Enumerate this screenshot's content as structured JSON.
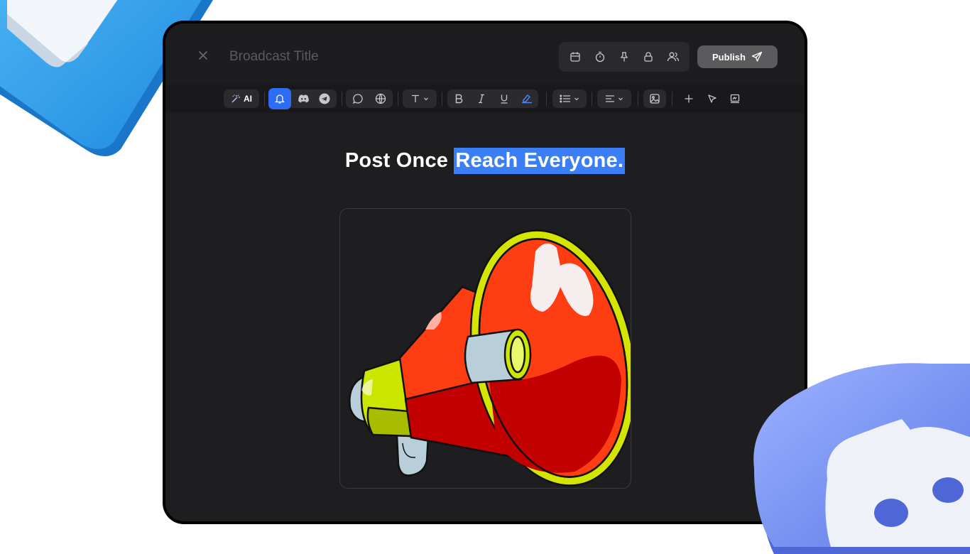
{
  "header": {
    "close_icon": "close-icon",
    "title_placeholder": "Broadcast Title",
    "icons": [
      "calendar-icon",
      "timer-icon",
      "pin-icon",
      "lock-icon",
      "users-icon"
    ],
    "publish_label": "Publish"
  },
  "toolbar": {
    "ai_label": "AI",
    "groups": [
      [
        "ai-magic-icon"
      ],
      [
        "bell-icon",
        "discord-icon",
        "telegram-icon"
      ],
      [
        "chat-bubble-icon",
        "globe-icon"
      ],
      [
        "text-type-icon"
      ],
      [
        "bold-icon",
        "italic-icon",
        "underline-icon",
        "highlight-icon"
      ],
      [
        "list-icon"
      ],
      [
        "align-icon"
      ],
      [
        "image-icon"
      ],
      [
        "plus-icon",
        "cursor-icon",
        "signature-icon"
      ]
    ]
  },
  "content": {
    "headline_plain": "Post Once",
    "headline_highlight": "Reach Everyone.",
    "image": "megaphone-illustration"
  },
  "colors": {
    "accent": "#2f6cf6",
    "highlight": "#3a7ff5",
    "window_bg": "#1e1e20",
    "publish_bg": "#5b5b5e"
  }
}
